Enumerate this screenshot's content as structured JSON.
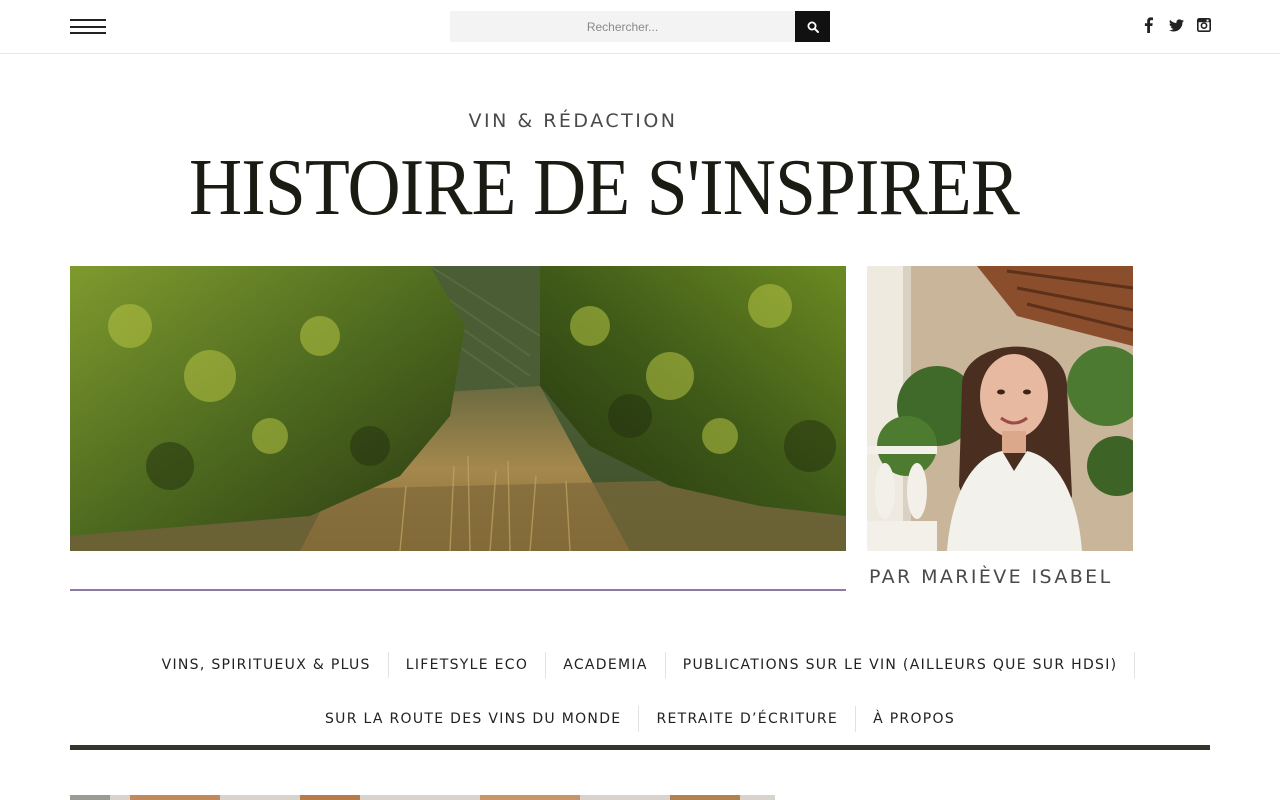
{
  "search": {
    "placeholder": "Rechercher..."
  },
  "social": {
    "icons": [
      "facebook-icon",
      "twitter-icon",
      "instagram-icon"
    ]
  },
  "header": {
    "tagline": "VIN & RÉDACTION",
    "title": "HISTOIRE DE S'INSPIRER"
  },
  "hero": {
    "byline": "PAR MARIÈVE ISABEL"
  },
  "nav": {
    "row1": [
      {
        "label": "VINS, SPIRITUEUX & PLUS"
      },
      {
        "label": "LIFETSYLE ECO"
      },
      {
        "label": "ACADEMIA"
      },
      {
        "label": "PUBLICATIONS SUR LE VIN (AILLEURS QUE SUR HDSI)"
      }
    ],
    "row2": [
      {
        "label": "SUR LA ROUTE DES VINS DU MONDE"
      },
      {
        "label": "RETRAITE D’ÉCRITURE"
      },
      {
        "label": "À PROPOS"
      }
    ]
  },
  "colors": {
    "accent_line": "#8e7aa6",
    "nav_rule": "#33372b",
    "title": "#1a1c14"
  }
}
